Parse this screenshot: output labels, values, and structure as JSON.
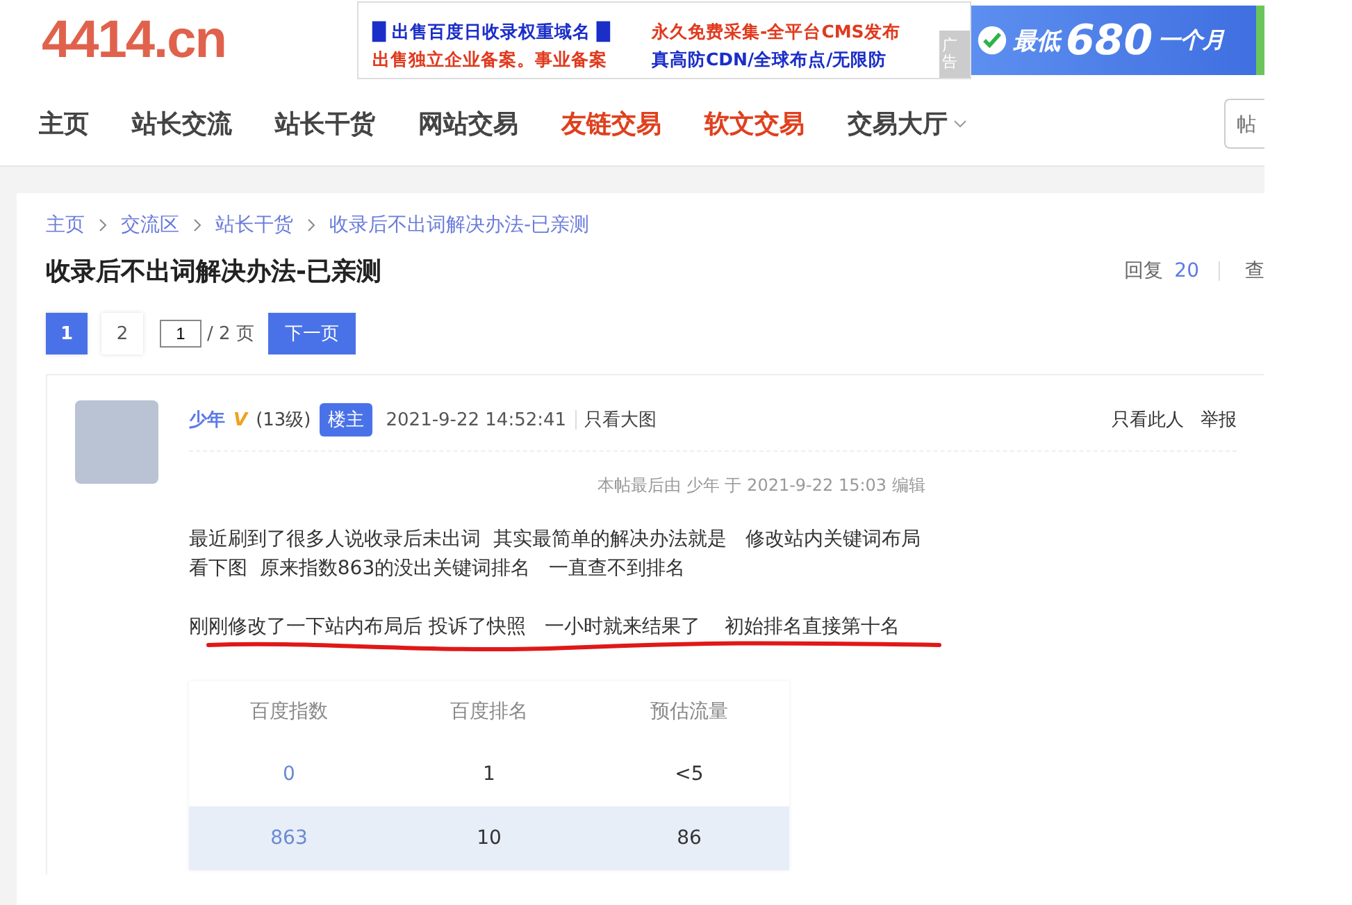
{
  "header": {
    "logo": "4414.cn",
    "ads": [
      {
        "text": "█ 出售百度日收录权重域名 █",
        "color": "#1b2ec8"
      },
      {
        "text": "永久免费采集-全平台CMS发布",
        "color": "#e03a1e"
      },
      {
        "text": "出售独立企业备案。事业备案",
        "color": "#e03a1e"
      },
      {
        "text": "真高防CDN/全球布点/无限防",
        "color": "#1b2ec8"
      }
    ],
    "ad_tag": "广告",
    "banner": {
      "prefix": "最低",
      "price": "680",
      "suffix": "一个月"
    }
  },
  "nav": [
    {
      "label": "主页",
      "hot": false,
      "kind": "link"
    },
    {
      "label": "站长交流",
      "hot": false,
      "kind": "link"
    },
    {
      "label": "站长干货",
      "hot": false,
      "kind": "link"
    },
    {
      "label": "网站交易",
      "hot": false,
      "kind": "link"
    },
    {
      "label": "友链交易",
      "hot": true,
      "kind": "link"
    },
    {
      "label": "软文交易",
      "hot": true,
      "kind": "link"
    },
    {
      "label": "交易大厅",
      "hot": false,
      "kind": "dropdown"
    }
  ],
  "search": {
    "placeholder": "帖"
  },
  "breadcrumb": [
    "主页",
    "交流区",
    "站长干货",
    "收录后不出词解决办法-已亲测"
  ],
  "thread": {
    "title": "收录后不出词解决办法-已亲测",
    "reply_label": "回复",
    "reply_count": "20",
    "view_label": "查"
  },
  "pagination": {
    "pages": [
      {
        "label": "1",
        "selected": true
      },
      {
        "label": "2",
        "selected": false
      }
    ],
    "input": "1",
    "total": "/ 2 页",
    "next": "下一页"
  },
  "post": {
    "author": "少年",
    "vip": "V",
    "level": "(13级)",
    "badge": "楼主",
    "time": "2021-9-22 14:52:41",
    "view_image": "只看大图",
    "actions": [
      "只看此人",
      "举报"
    ],
    "edit_note": "本帖最后由 少年 于 2021-9-22 15:03 编辑",
    "paragraphs": [
      "最近刷到了很多人说收录后未出词  其实最简单的解决办法就是   修改站内关键词布局",
      "看下图  原来指数863的没出关键词排名   一直查不到排名"
    ],
    "highlight": "刚刚修改了一下站内布局后 投诉了快照   一小时就来结果了    初始排名直接第十名",
    "table": {
      "columns": [
        "百度指数",
        "百度排名",
        "预估流量"
      ],
      "rows": [
        {
          "cells": [
            "0",
            "1",
            "<5"
          ],
          "highlighted": false
        },
        {
          "cells": [
            "863",
            "10",
            "86"
          ],
          "highlighted": true
        }
      ]
    }
  }
}
